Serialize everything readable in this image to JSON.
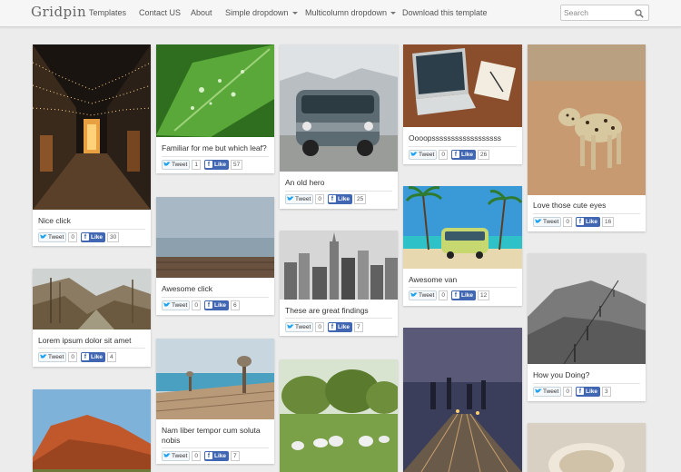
{
  "brand": "Gridpin",
  "nav": {
    "templates": "Templates",
    "contact": "Contact US",
    "about": "About",
    "simple_dropdown": "Simple dropdown",
    "multicolumn_dropdown": "Multicolumn dropdown",
    "download": "Download this template"
  },
  "search": {
    "placeholder": "Search"
  },
  "buttons": {
    "tweet": "Tweet",
    "like": "Like"
  },
  "pins": [
    {
      "caption": "Nice click",
      "tweets": "0",
      "likes": "30"
    },
    {
      "caption": "Familiar for me but which leaf?",
      "tweets": "1",
      "likes": "57"
    },
    {
      "caption": "An old hero",
      "tweets": "0",
      "likes": "25"
    },
    {
      "caption": "Oooopssssssssssssssssss",
      "tweets": "0",
      "likes": "26"
    },
    {
      "caption": "Love those cute eyes",
      "tweets": "0",
      "likes": "16"
    },
    {
      "caption": "Lorem ipsum dolor sit amet",
      "tweets": "0",
      "likes": "4"
    },
    {
      "caption": "Awesome click",
      "tweets": "0",
      "likes": "6"
    },
    {
      "caption": "These are great findings",
      "tweets": "0",
      "likes": "7"
    },
    {
      "caption": "Awesome van",
      "tweets": "0",
      "likes": "12"
    },
    {
      "caption": "How you Doing?",
      "tweets": "0",
      "likes": "3"
    },
    {
      "caption": "Nam liber tempor cum soluta nobis",
      "tweets": "0",
      "likes": "7"
    }
  ],
  "colors": {
    "like_blue": "#4267b2",
    "twitter_blue": "#1da1f2",
    "page_bg": "#ececec"
  }
}
